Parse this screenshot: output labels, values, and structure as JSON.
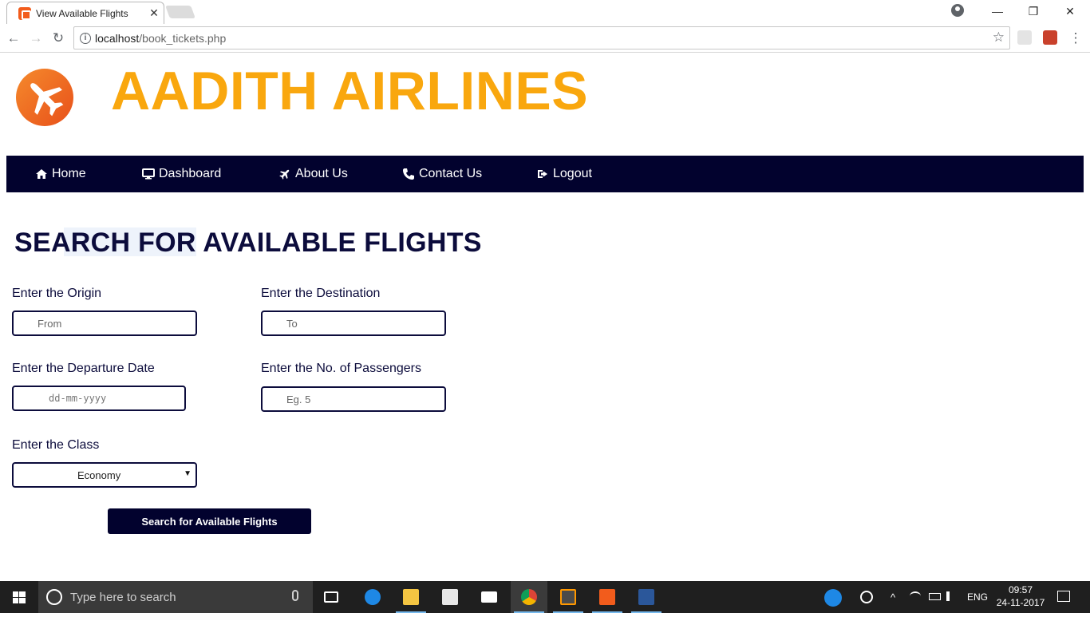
{
  "browser": {
    "tab_title": "View Available Flights",
    "tab_close": "✕",
    "url_host": "localhost",
    "url_path": "/book_tickets.php",
    "window_minimize": "—",
    "window_restore": "❐",
    "window_close": "✕",
    "back": "←",
    "forward": "→",
    "reload": "↻",
    "star": "☆",
    "menu": "⋮"
  },
  "site": {
    "brand": "AADITH AIRLINES",
    "colors": {
      "brand": "#f9a70e",
      "navbar": "#02022e",
      "text": "#0c0c3c"
    }
  },
  "navbar": {
    "items": [
      {
        "label": "Home",
        "icon": "home-icon"
      },
      {
        "label": "Dashboard",
        "icon": "desktop-icon"
      },
      {
        "label": "About Us",
        "icon": "plane-icon"
      },
      {
        "label": "Contact Us",
        "icon": "phone-icon"
      },
      {
        "label": "Logout",
        "icon": "sign-out-icon"
      }
    ]
  },
  "form": {
    "heading": "SEARCH FOR AVAILABLE FLIGHTS",
    "origin_label": "Enter the Origin",
    "origin_placeholder": "From",
    "destination_label": "Enter the Destination",
    "destination_placeholder": "To",
    "date_label": "Enter the Departure Date",
    "date_placeholder": "dd-mm-yyyy",
    "passengers_label": "Enter the No. of Passengers",
    "passengers_placeholder": "Eg. 5",
    "class_label": "Enter the Class",
    "class_value": "Economy",
    "submit_label": "Search for Available Flights"
  },
  "taskbar": {
    "search_placeholder": "Type here to search",
    "language": "ENG",
    "time": "09:57",
    "date": "24-11-2017"
  }
}
